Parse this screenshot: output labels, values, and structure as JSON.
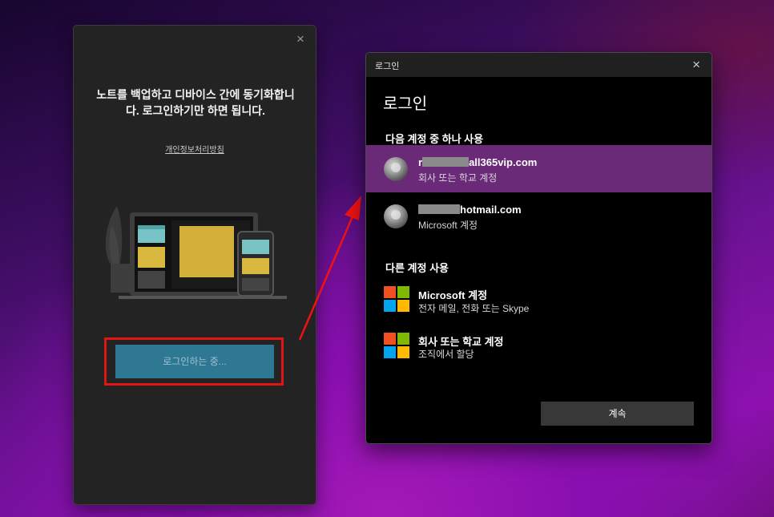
{
  "onenote_window": {
    "close_label": "×",
    "message": "노트를 백업하고 디바이스 간에 동기화합니다. 로그인하기만 하면 됩니다.",
    "privacy_link": "개인정보처리방침",
    "signin_button": "로그인하는 중..."
  },
  "login_dialog": {
    "window_title": "로그인",
    "close_label": "×",
    "heading": "로그인",
    "use_account_label": "다음 계정 중 하나 사용",
    "accounts": [
      {
        "email_prefix": "r",
        "email_suffix": "all365vip.com",
        "type": "회사 또는 학교 계정",
        "selected": true
      },
      {
        "email_prefix": "",
        "email_suffix": "hotmail.com",
        "type": "Microsoft 계정",
        "selected": false
      }
    ],
    "other_account_label": "다른 계정 사용",
    "options": [
      {
        "title": "Microsoft 계정",
        "subtitle": "전자 메일, 전화 또는 Skype"
      },
      {
        "title": "회사 또는 학교 계정",
        "subtitle": "조직에서 할당"
      }
    ],
    "continue_button": "계속"
  },
  "colors": {
    "selected_row": "#6a2a78",
    "signin_button": "#2e7894",
    "highlight_box": "#e31414",
    "ms_red": "#f25022",
    "ms_green": "#7fba00",
    "ms_blue": "#00a4ef",
    "ms_yellow": "#ffb900"
  },
  "icons": {
    "close": "close-icon",
    "avatar": "user-avatar",
    "microsoft_logo": "microsoft-logo-icon"
  }
}
